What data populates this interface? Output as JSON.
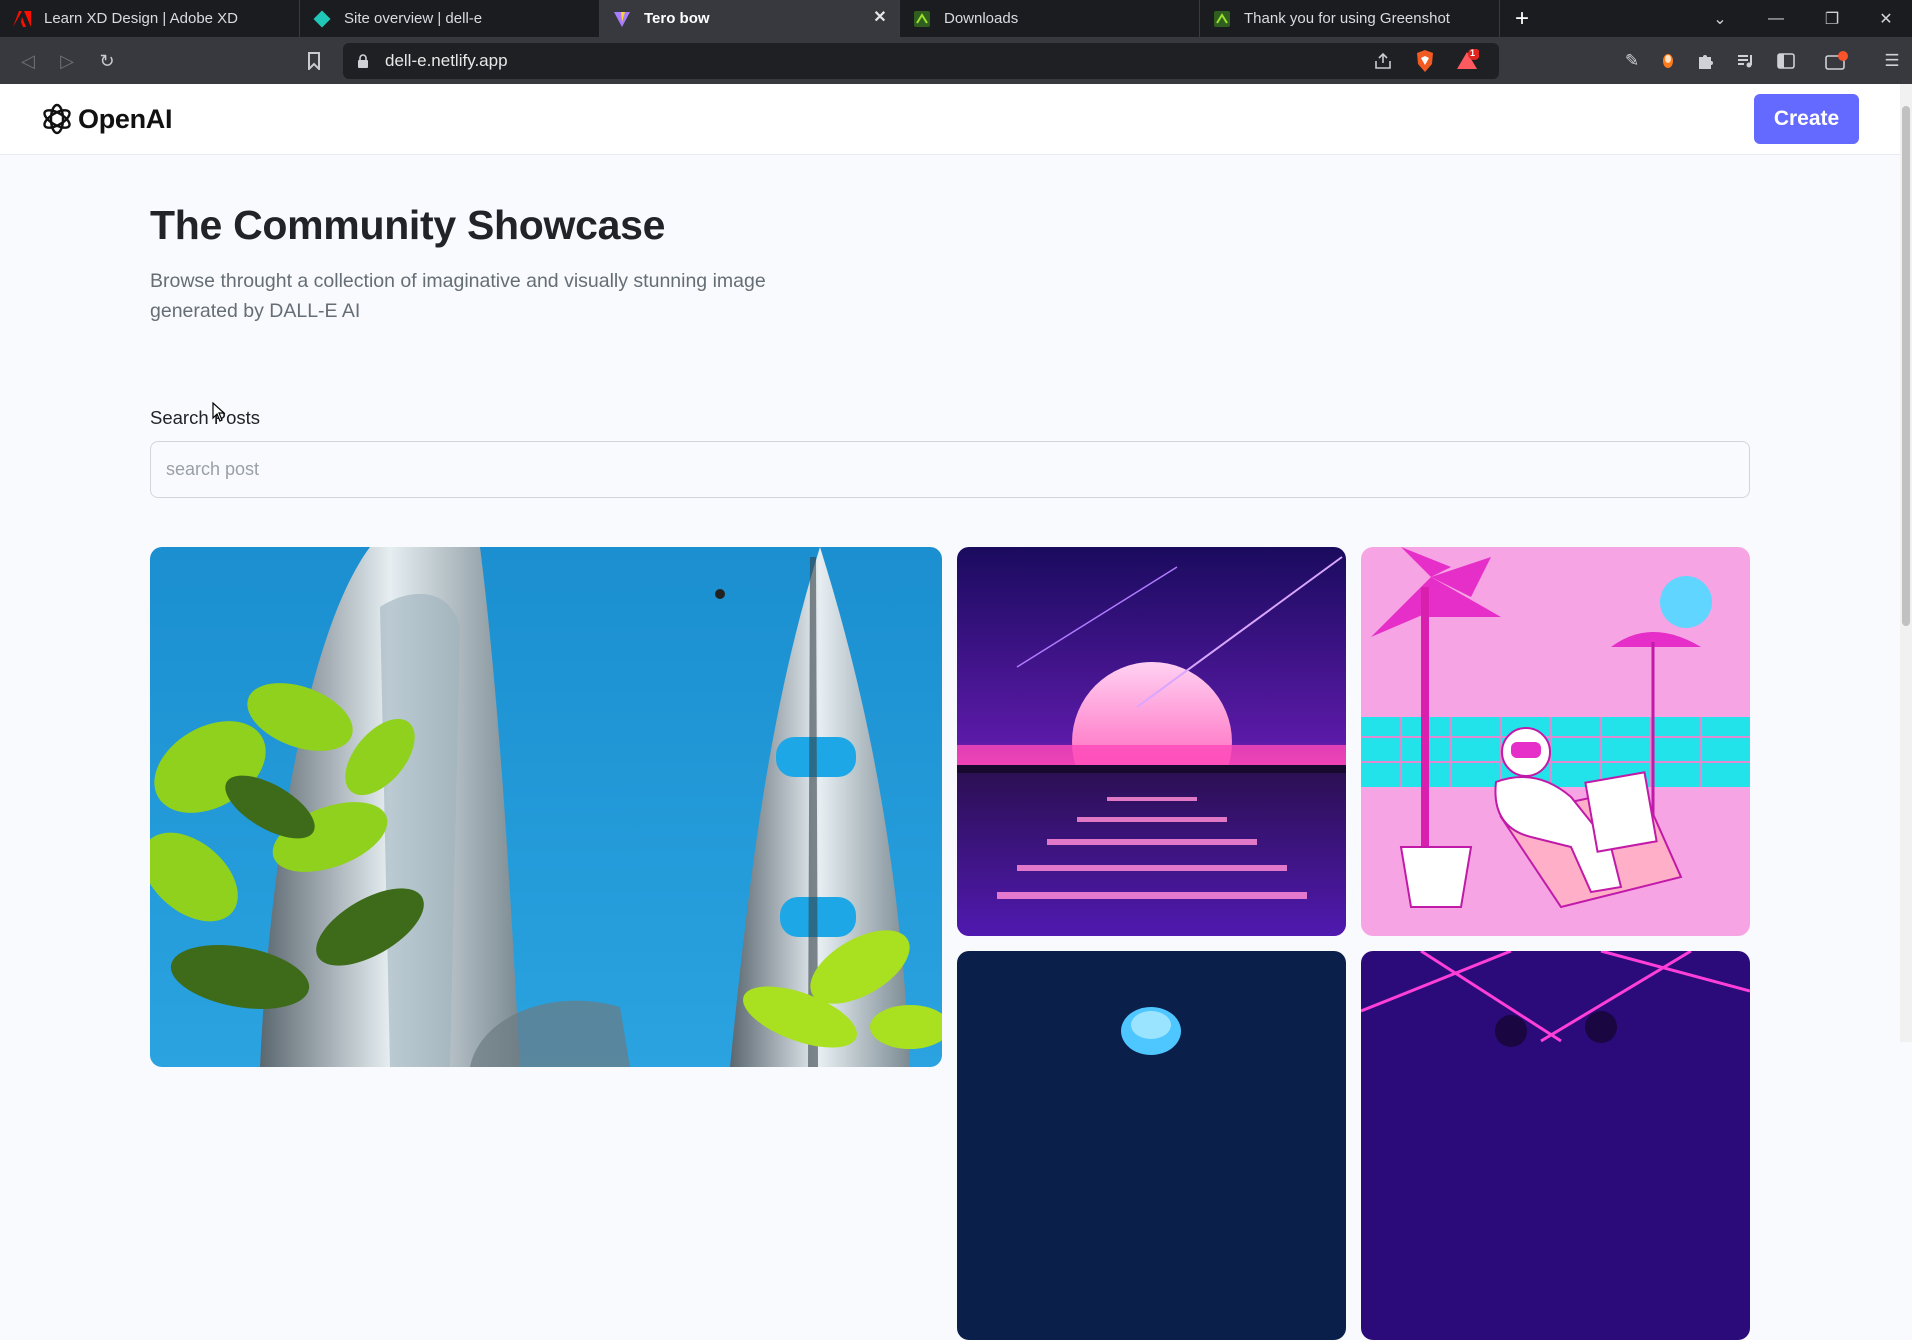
{
  "browser": {
    "tabs": [
      {
        "title": "Learn XD Design | Adobe XD",
        "active": false
      },
      {
        "title": "Site overview | dell-e",
        "active": false
      },
      {
        "title": "Tero bow",
        "active": true
      },
      {
        "title": "Downloads",
        "active": false
      },
      {
        "title": "Thank you for using Greenshot",
        "active": false
      }
    ],
    "url": "dell-e.netlify.app",
    "notification_count": "1"
  },
  "header": {
    "logo_text": "OpenAI",
    "create_label": "Create"
  },
  "main": {
    "title": "The Community Showcase",
    "subtitle": "Browse throught a collection of imaginative and visually stunning image generated by DALL-E AI"
  },
  "search": {
    "label": "Search Posts",
    "placeholder": "search post"
  },
  "colors": {
    "accent": "#6469ff",
    "page_bg": "#f9fafe",
    "title": "#222328",
    "subtitle": "#666e75"
  },
  "gallery": {
    "images": [
      {
        "subject": "futuristic glass towers with plants"
      },
      {
        "subject": "synthwave sunset over water"
      },
      {
        "subject": "astronaut relaxing by pool with palm trees"
      },
      {
        "subject": "jellyfish in dark ocean"
      },
      {
        "subject": "neon laser concert"
      }
    ]
  }
}
